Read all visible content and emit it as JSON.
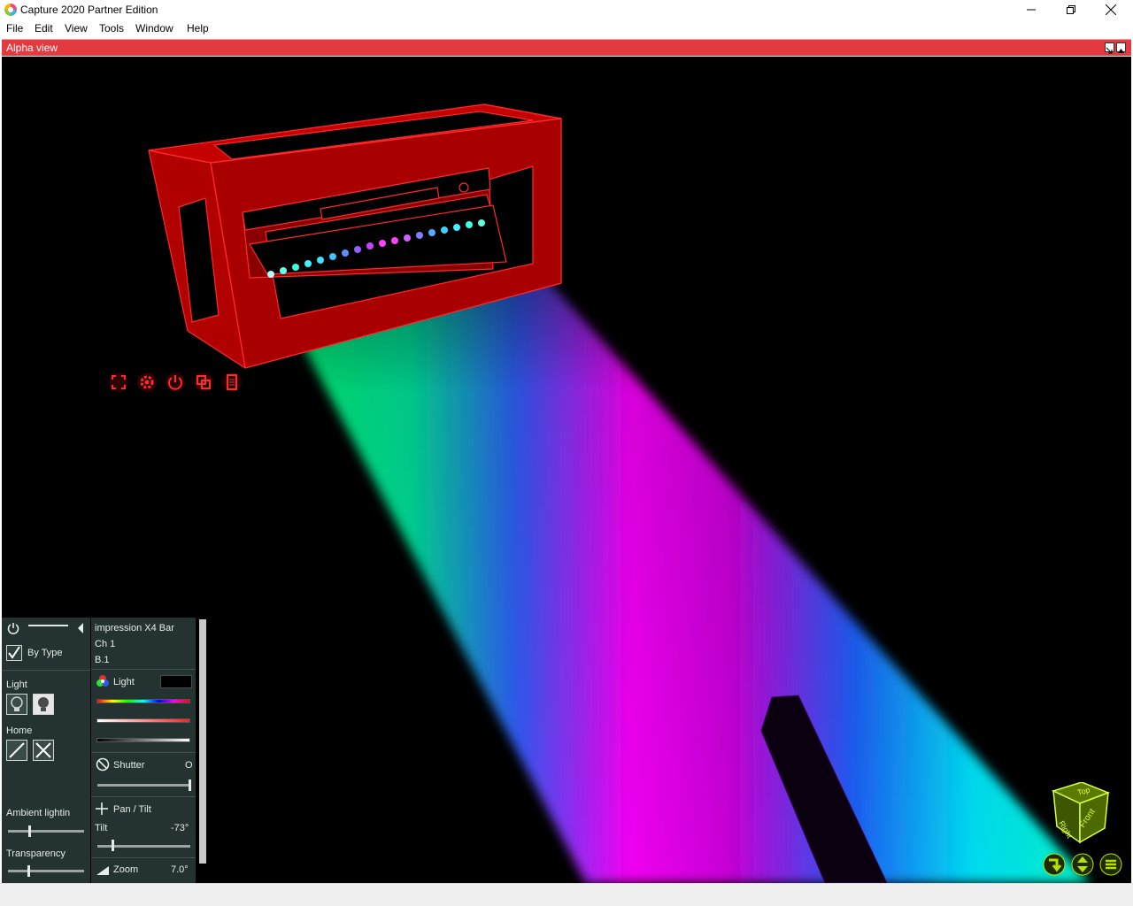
{
  "window": {
    "title": "Capture 2020 Partner Edition"
  },
  "menu": [
    "File",
    "Edit",
    "View",
    "Tools",
    "Window",
    "Help"
  ],
  "view": {
    "title": "Alpha view"
  },
  "fixture": {
    "name": "impression X4 Bar",
    "channel": "Ch 1",
    "id": "B.1"
  },
  "left_panel": {
    "by_type_label": "By Type",
    "by_type_checked": true,
    "light_label": "Light",
    "home_label": "Home",
    "ambient_label": "Ambient lightin",
    "ambient_value": 0.27,
    "transparency_label": "Transparency",
    "transparency_value": 0.25
  },
  "right_panel": {
    "light_label": "Light",
    "shutter_label": "Shutter",
    "shutter_value": "O",
    "pantilt_label": "Pan / Tilt",
    "tilt_label": "Tilt",
    "tilt_value": "-73°",
    "tilt_level": 0.15,
    "zoom_label": "Zoom",
    "zoom_value": "7.0°"
  },
  "viewcube": {
    "top_label": "Top",
    "right_label": "Right",
    "front_label": "Front"
  },
  "colors": {
    "accent_red": "#e23a3f",
    "panel_bg": "#243331",
    "fixture_red": "#d00000",
    "viewcube_green": "#6a8f00"
  },
  "icons": {
    "fixture_toolbar": [
      "focus-icon",
      "settings-icon",
      "power-icon",
      "layers-icon",
      "document-icon"
    ],
    "bottom_right": [
      "rotate-icon",
      "arrows-icon",
      "menu-icon"
    ]
  }
}
